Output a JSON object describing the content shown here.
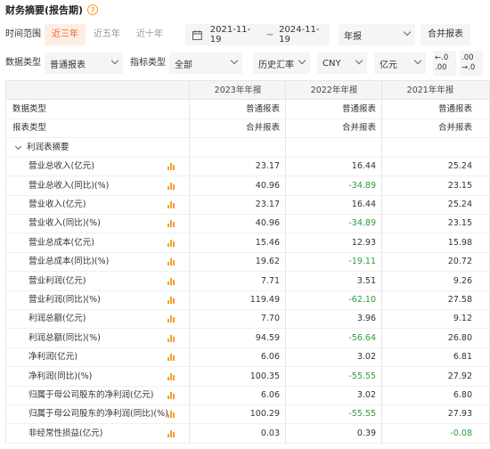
{
  "title": "财务摘要(报告期)",
  "help_icon": "?",
  "filter": {
    "time_range_label": "时间范围",
    "tabs": [
      "近三年",
      "近五年",
      "近十年"
    ],
    "active_tab": "近三年",
    "date_start": "2021-11-19",
    "date_sep": "~",
    "date_end": "2024-11-19",
    "period_select": "年报",
    "report_type_button": "合并报表"
  },
  "filter2": {
    "data_type_label": "数据类型",
    "data_type_value": "普通报表",
    "indicator_type_label": "指标类型",
    "indicator_type_value": "全部",
    "fx_select": "历史汇率",
    "currency_select": "CNY",
    "unit_select": "亿元",
    "dec_decrease": [
      "←.0",
      ".00"
    ],
    "dec_increase": [
      ".00",
      "→.0"
    ]
  },
  "table": {
    "columns": [
      "2023年年报",
      "2022年年报",
      "2021年年报"
    ],
    "meta_rows": [
      {
        "label": "数据类型",
        "values": [
          "普通报表",
          "普通报表",
          "普通报表"
        ]
      },
      {
        "label": "报表类型",
        "values": [
          "合并报表",
          "合并报表",
          "合并报表"
        ]
      }
    ],
    "section_title": "利润表摘要",
    "rows": [
      {
        "label": "营业总收入(亿元)",
        "values": [
          "23.17",
          "16.44",
          "25.24"
        ],
        "neg": [
          false,
          false,
          false
        ]
      },
      {
        "label": "营业总收入(同比)(%)",
        "values": [
          "40.96",
          "-34.89",
          "23.15"
        ],
        "neg": [
          false,
          true,
          false
        ]
      },
      {
        "label": "营业收入(亿元)",
        "values": [
          "23.17",
          "16.44",
          "25.24"
        ],
        "neg": [
          false,
          false,
          false
        ]
      },
      {
        "label": "营业收入(同比)(%)",
        "values": [
          "40.96",
          "-34.89",
          "23.15"
        ],
        "neg": [
          false,
          true,
          false
        ]
      },
      {
        "label": "营业总成本(亿元)",
        "values": [
          "15.46",
          "12.93",
          "15.98"
        ],
        "neg": [
          false,
          false,
          false
        ]
      },
      {
        "label": "营业总成本(同比)(%)",
        "values": [
          "19.62",
          "-19.11",
          "20.72"
        ],
        "neg": [
          false,
          true,
          false
        ]
      },
      {
        "label": "营业利润(亿元)",
        "values": [
          "7.71",
          "3.51",
          "9.26"
        ],
        "neg": [
          false,
          false,
          false
        ]
      },
      {
        "label": "营业利润(同比)(%)",
        "values": [
          "119.49",
          "-62.10",
          "27.58"
        ],
        "neg": [
          false,
          true,
          false
        ]
      },
      {
        "label": "利润总额(亿元)",
        "values": [
          "7.70",
          "3.96",
          "9.12"
        ],
        "neg": [
          false,
          false,
          false
        ]
      },
      {
        "label": "利润总额(同比)(%)",
        "values": [
          "94.59",
          "-56.64",
          "26.80"
        ],
        "neg": [
          false,
          true,
          false
        ]
      },
      {
        "label": "净利润(亿元)",
        "values": [
          "6.06",
          "3.02",
          "6.81"
        ],
        "neg": [
          false,
          false,
          false
        ]
      },
      {
        "label": "净利润(同比)(%)",
        "values": [
          "100.35",
          "-55.55",
          "27.92"
        ],
        "neg": [
          false,
          true,
          false
        ]
      },
      {
        "label": "归属于母公司股东的净利润(亿元)",
        "values": [
          "6.06",
          "3.02",
          "6.80"
        ],
        "neg": [
          false,
          false,
          false
        ]
      },
      {
        "label": "归属于母公司股东的净利润(同比)(%)",
        "values": [
          "100.29",
          "-55.55",
          "27.93"
        ],
        "neg": [
          false,
          true,
          false
        ]
      },
      {
        "label": "非经常性损益(亿元)",
        "values": [
          "0.03",
          "0.39",
          "-0.08"
        ],
        "neg": [
          false,
          false,
          true
        ]
      }
    ]
  },
  "colors": {
    "accent": "#f26522",
    "negative": "#2a9d3c",
    "chart_icon": "#f0a030"
  },
  "icons": {
    "help": "help-circle-icon",
    "calendar": "calendar-icon",
    "chart": "bar-chart-icon",
    "chevron": "chevron-down-icon"
  }
}
